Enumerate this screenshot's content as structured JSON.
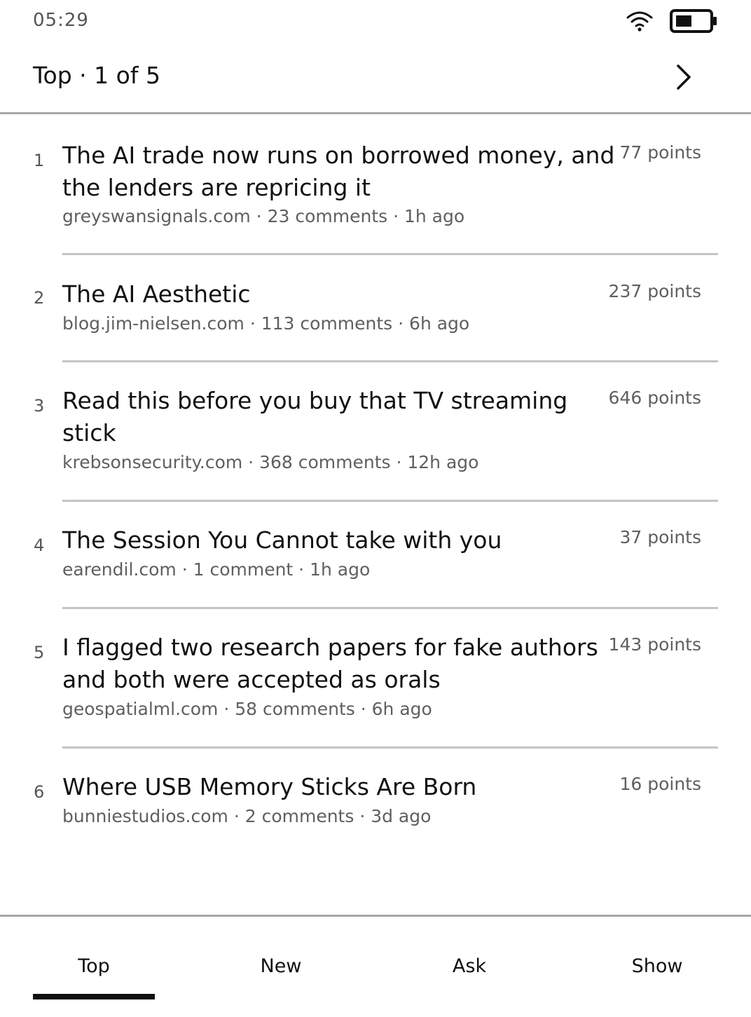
{
  "status": {
    "time": "05:29",
    "wifi_icon": "wifi-icon",
    "battery_icon": "battery-icon"
  },
  "header": {
    "title": "Top · 1 of 5",
    "next_icon": "chevron-right-icon"
  },
  "stories": [
    {
      "rank": "1",
      "title_lines": [
        "The AI trade now runs on borrowed money, and",
        "the lenders are repricing it"
      ],
      "meta": "greyswansignals.com · 23 comments · 1h ago",
      "points": "77 points"
    },
    {
      "rank": "2",
      "title_lines": [
        "The AI Aesthetic"
      ],
      "meta": "blog.jim-nielsen.com · 113 comments · 6h ago",
      "points": "237 points"
    },
    {
      "rank": "3",
      "title_lines": [
        "Read this before you buy that TV streaming",
        "stick"
      ],
      "meta": "krebsonsecurity.com · 368 comments · 12h ago",
      "points": "646 points"
    },
    {
      "rank": "4",
      "title_lines": [
        "The Session You Cannot take with you"
      ],
      "meta": "earendil.com · 1 comment · 1h ago",
      "points": "37 points"
    },
    {
      "rank": "5",
      "title_lines": [
        "I flagged two research papers for fake authors",
        "and both were accepted as orals"
      ],
      "meta": "geospatialml.com · 58 comments · 6h ago",
      "points": "143 points"
    },
    {
      "rank": "6",
      "title_lines": [
        "Where USB Memory Sticks Are Born"
      ],
      "meta": "bunniestudios.com · 2 comments · 3d ago",
      "points": "16 points"
    }
  ],
  "tabs": [
    {
      "label": "Top",
      "active": true
    },
    {
      "label": "New",
      "active": false
    },
    {
      "label": "Ask",
      "active": false
    },
    {
      "label": "Show",
      "active": false
    }
  ]
}
